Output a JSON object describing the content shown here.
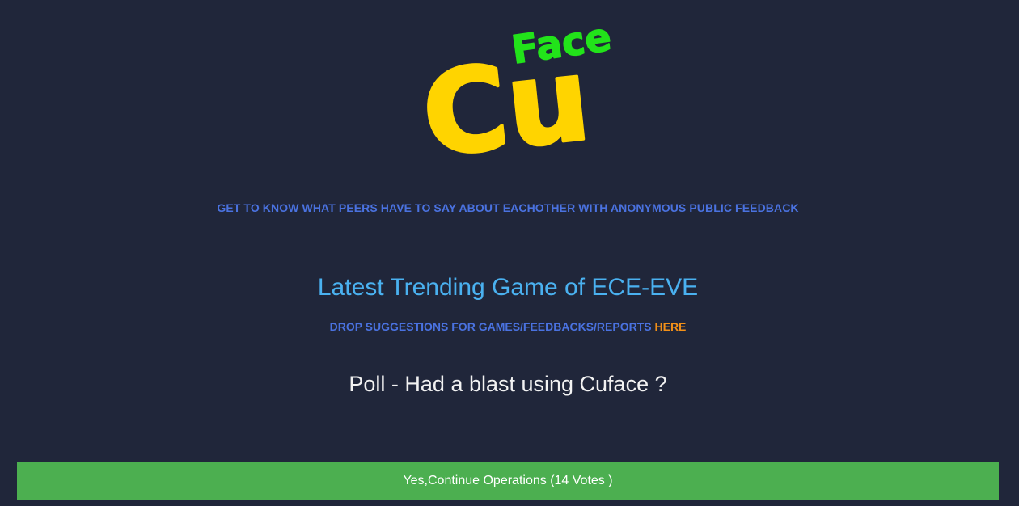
{
  "brand": {
    "logo_word_large": "Cu",
    "logo_word_small": "Face",
    "colors": {
      "background": "#20263a",
      "logo_yellow": "#ffd400",
      "logo_green": "#22e31a"
    }
  },
  "tagline": "GET TO KNOW WHAT PEERS HAVE TO SAY ABOUT EACHOTHER WITH ANONYMOUS PUBLIC FEEDBACK",
  "trending": {
    "title": "Latest Trending Game of ECE-EVE",
    "suggestion_text": "DROP SUGGESTIONS FOR GAMES/FEEDBACKS/REPORTS ",
    "suggestion_link": "HERE"
  },
  "poll": {
    "question": "Poll - Had a blast using Cuface ?",
    "options": [
      {
        "label": "Yes,Continue Operations (14 Votes )",
        "color": "#4caf50"
      }
    ]
  }
}
